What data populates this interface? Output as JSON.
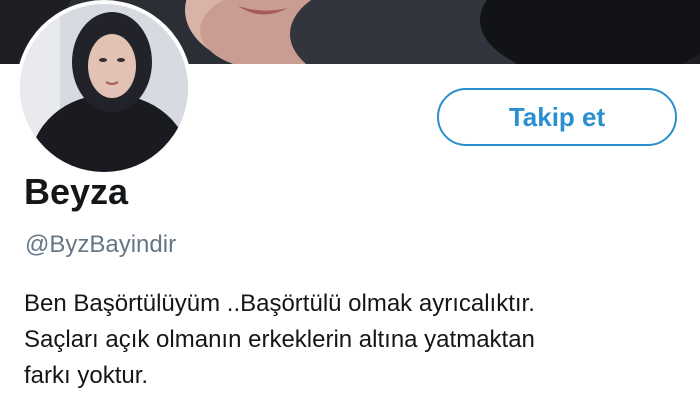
{
  "profile": {
    "display_name": "Beyza",
    "handle": "@ByzBayindir",
    "follow_label": "Takip et",
    "bio_lines": [
      "Ben Başörtülüyüm ..Başörtülü olmak ayrıcalıktır.",
      "Saçları açık olmanın erkeklerin altına yatmaktan",
      "farkı yoktur."
    ]
  },
  "colors": {
    "accent": "#2a8fce",
    "text_primary": "#14171a",
    "text_secondary": "#657786"
  }
}
